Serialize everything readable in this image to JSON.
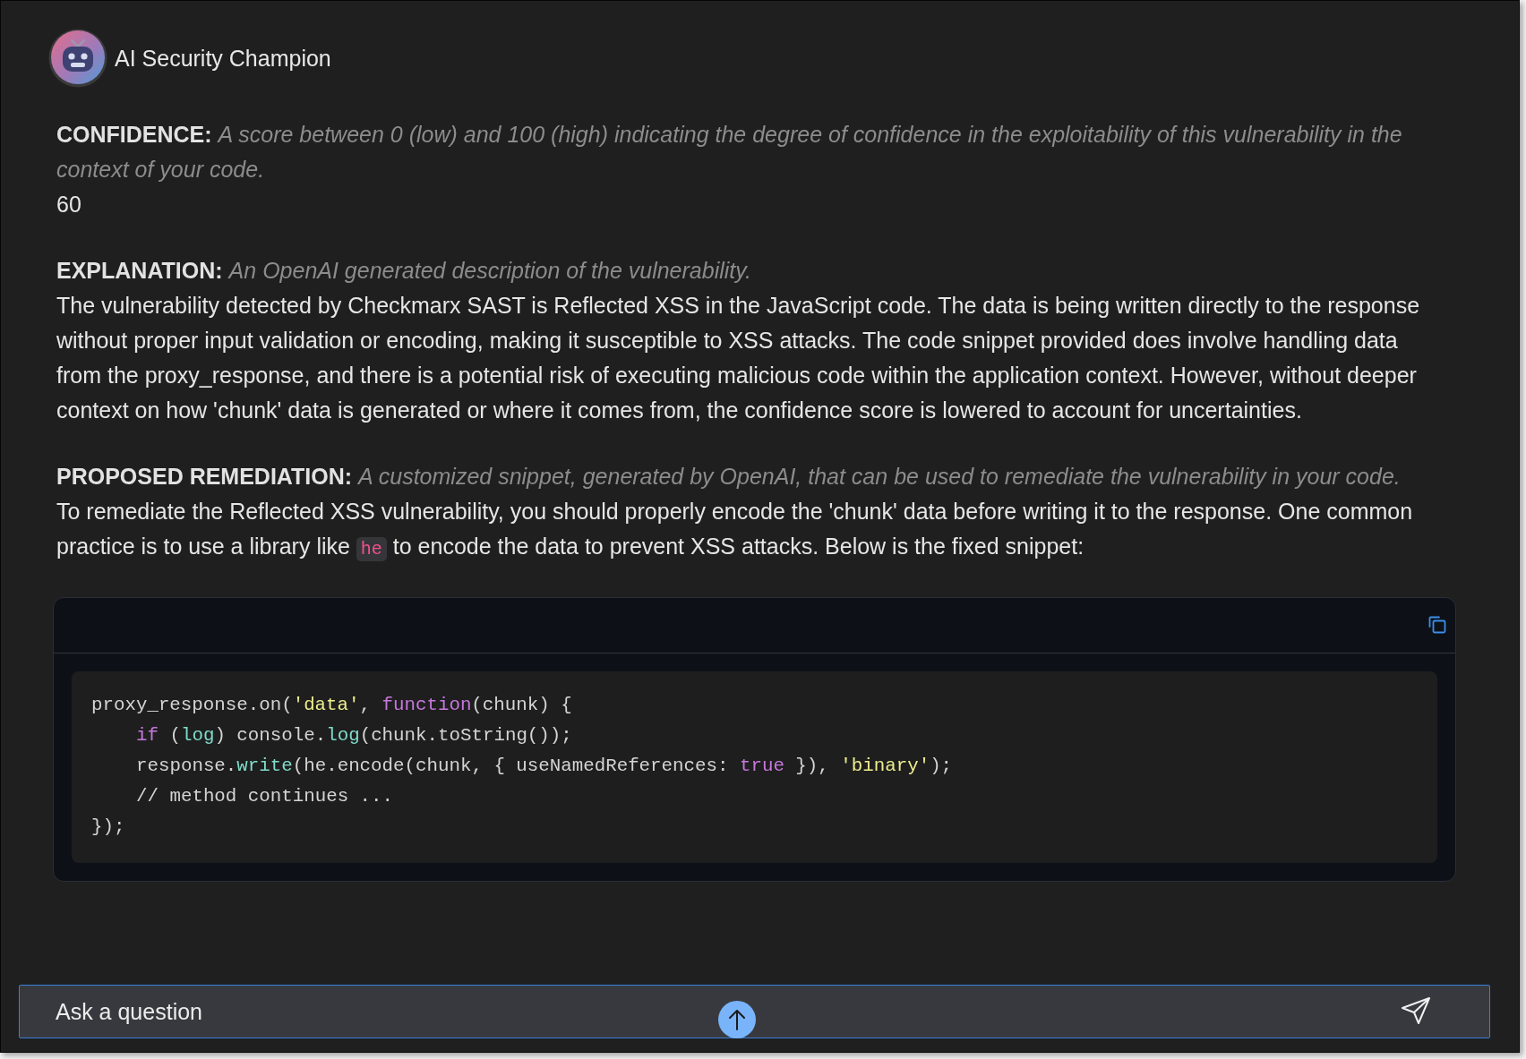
{
  "header": {
    "title": "AI Security Champion"
  },
  "sections": [
    {
      "label": "CONFIDENCE:",
      "description": "A score between 0 (low) and 100 (high) indicating the degree of confidence in the exploitability of this vulnerability in the context of your code.",
      "body": [
        {
          "kind": "text",
          "text": "60"
        }
      ]
    },
    {
      "label": "EXPLANATION:",
      "description": "An OpenAI generated description of the vulnerability.",
      "body": [
        {
          "kind": "text",
          "text": "The vulnerability detected by Checkmarx SAST is Reflected XSS in the JavaScript code. The data is being written directly to the response without proper input validation or encoding, making it susceptible to XSS attacks. The code snippet provided does involve handling data from the proxy_response, and there is a potential risk of executing malicious code within the application context. However, without deeper context on how 'chunk' data is generated or where it comes from, the confidence score is lowered to account for uncertainties."
        }
      ]
    },
    {
      "label": "PROPOSED REMEDIATION:",
      "description": "A customized snippet, generated by OpenAI, that can be used to remediate the vulnerability in your code.",
      "body": [
        {
          "kind": "text",
          "text": "To remediate the Reflected XSS vulnerability, you should properly encode the 'chunk' data before writing it to the response. One common practice is to use a library like "
        },
        {
          "kind": "code",
          "text": "he"
        },
        {
          "kind": "text",
          "text": " to encode the data to prevent XSS attacks. Below is the fixed snippet:"
        }
      ]
    }
  ],
  "code_block": {
    "lines": [
      {
        "tokens": [
          {
            "kind": "plain",
            "text": "proxy_response.on("
          },
          {
            "kind": "string",
            "text": "'data'"
          },
          {
            "kind": "plain",
            "text": ", "
          },
          {
            "kind": "keyword",
            "text": "function"
          },
          {
            "kind": "plain",
            "text": "(chunk) {"
          }
        ],
        "children": [
          {
            "tokens": [
              {
                "kind": "keyword",
                "text": "if"
              },
              {
                "kind": "plain",
                "text": " ("
              },
              {
                "kind": "function",
                "text": "log"
              },
              {
                "kind": "plain",
                "text": ") console."
              },
              {
                "kind": "function",
                "text": "log"
              },
              {
                "kind": "plain",
                "text": "(chunk.toString());"
              }
            ]
          },
          {
            "tokens": [
              {
                "kind": "plain",
                "text": "response."
              },
              {
                "kind": "function",
                "text": "write"
              },
              {
                "kind": "plain",
                "text": "(he.encode(chunk, { useNamedReferences: "
              },
              {
                "kind": "keyword",
                "text": "true"
              },
              {
                "kind": "plain",
                "text": " }), "
              },
              {
                "kind": "string",
                "text": "'binary'"
              },
              {
                "kind": "plain",
                "text": ");"
              }
            ]
          },
          {
            "tokens": [
              {
                "kind": "plain",
                "text": "// method continues ..."
              }
            ]
          }
        ]
      },
      {
        "tokens": [
          {
            "kind": "plain",
            "text": "});"
          }
        ]
      }
    ]
  },
  "input": {
    "placeholder": "Ask a question"
  }
}
